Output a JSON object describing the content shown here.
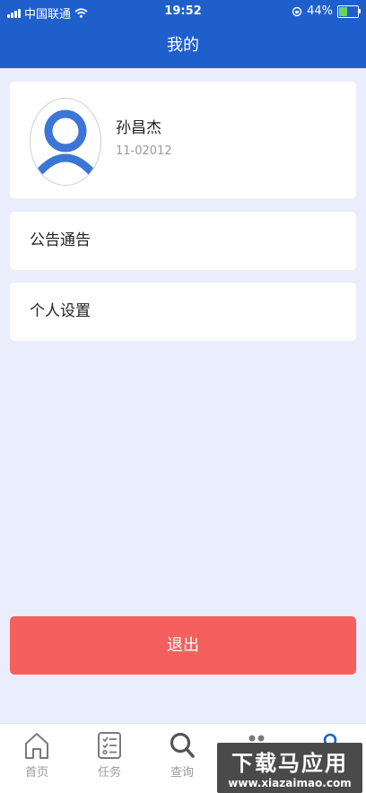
{
  "status_bar": {
    "carrier": "中国联通",
    "time": "19:52",
    "battery_percent": "44%",
    "battery_level": 0.44
  },
  "header": {
    "title": "我的"
  },
  "profile": {
    "name": "孙昌杰",
    "id": "11-02012"
  },
  "menu": {
    "notice_label": "公告通告",
    "settings_label": "个人设置"
  },
  "logout": {
    "label": "退出"
  },
  "tabs": [
    {
      "label": "首页",
      "icon": "home-icon"
    },
    {
      "label": "任务",
      "icon": "task-list-icon"
    },
    {
      "label": "查询",
      "icon": "search-icon"
    },
    {
      "label": "",
      "icon": "group-icon"
    },
    {
      "label": "",
      "icon": "user-icon"
    }
  ],
  "watermark": {
    "title": "下载马应用",
    "url": "www.xiazaimao.com"
  },
  "colors": {
    "primary": "#1f5fcc",
    "background": "#eaedfb",
    "logout": "#f5605e"
  }
}
